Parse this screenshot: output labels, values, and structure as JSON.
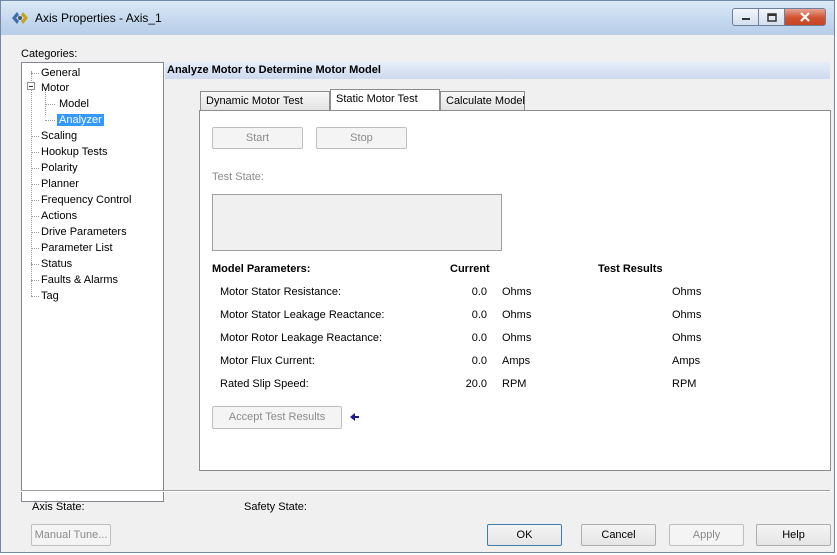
{
  "window": {
    "title": "Axis Properties - Axis_1"
  },
  "categories": {
    "label": "Categories:",
    "items": [
      {
        "label": "General"
      },
      {
        "label": "Motor"
      },
      {
        "label": "Model"
      },
      {
        "label": "Analyzer"
      },
      {
        "label": "Scaling"
      },
      {
        "label": "Hookup Tests"
      },
      {
        "label": "Polarity"
      },
      {
        "label": "Planner"
      },
      {
        "label": "Frequency Control"
      },
      {
        "label": "Actions"
      },
      {
        "label": "Drive Parameters"
      },
      {
        "label": "Parameter List"
      },
      {
        "label": "Status"
      },
      {
        "label": "Faults & Alarms"
      },
      {
        "label": "Tag"
      }
    ]
  },
  "header": {
    "title": "Analyze Motor to Determine Motor Model"
  },
  "tabs": [
    {
      "label": "Dynamic Motor Test"
    },
    {
      "label": "Static Motor Test"
    },
    {
      "label": "Calculate Model"
    }
  ],
  "panel": {
    "start_label": "Start",
    "stop_label": "Stop",
    "test_state_label": "Test State:",
    "headers": {
      "model_parameters": "Model Parameters:",
      "current": "Current",
      "test_results": "Test Results"
    },
    "rows": [
      {
        "name": "Motor Stator Resistance:",
        "value": "0.0",
        "unit": "Ohms",
        "result_unit": "Ohms"
      },
      {
        "name": "Motor Stator Leakage Reactance:",
        "value": "0.0",
        "unit": "Ohms",
        "result_unit": "Ohms"
      },
      {
        "name": "Motor Rotor Leakage Reactance:",
        "value": "0.0",
        "unit": "Ohms",
        "result_unit": "Ohms"
      },
      {
        "name": "Motor Flux Current:",
        "value": "0.0",
        "unit": "Amps",
        "result_unit": "Amps"
      },
      {
        "name": "Rated Slip Speed:",
        "value": "20.0",
        "unit": "RPM",
        "result_unit": "RPM"
      }
    ],
    "accept_label": "Accept Test Results"
  },
  "footer": {
    "axis_state_label": "Axis State:",
    "safety_state_label": "Safety State:",
    "manual_tune_label": "Manual Tune...",
    "ok_label": "OK",
    "cancel_label": "Cancel",
    "apply_label": "Apply",
    "help_label": "Help"
  },
  "colors": {
    "selection": "#3399ff",
    "close_button": "#c64525",
    "arrow": "#1a1a8c"
  },
  "icons": {
    "title": "axis-gear-icon",
    "arrow": "left-arrow-icon"
  }
}
